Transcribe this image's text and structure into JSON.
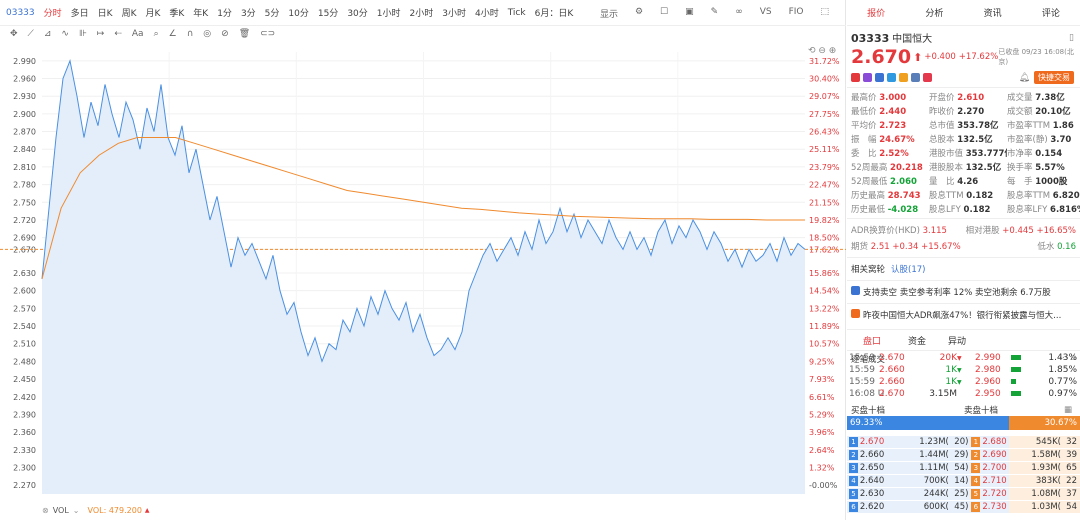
{
  "toolbar": {
    "code": "03333",
    "periods": [
      "分时",
      "多日",
      "日K",
      "周K",
      "月K",
      "季K",
      "年K",
      "1分",
      "3分",
      "5分",
      "10分",
      "15分",
      "30分",
      "1小时",
      "2小时",
      "3小时",
      "4小时",
      "Tick",
      "6月：日K"
    ],
    "right": [
      "显示",
      "VS",
      "FIO"
    ]
  },
  "chart_data": {
    "type": "line",
    "y_ticks": [
      "2.990",
      "2.960",
      "2.930",
      "2.900",
      "2.870",
      "2.840",
      "2.810",
      "2.780",
      "2.750",
      "2.720",
      "2.690",
      "2.670",
      "2.630",
      "2.600",
      "2.570",
      "2.540",
      "2.510",
      "2.480",
      "2.450",
      "2.420",
      "2.390",
      "2.360",
      "2.330",
      "2.300",
      "2.270"
    ],
    "pct_ticks": [
      "31.72%",
      "30.40%",
      "29.07%",
      "27.75%",
      "26.43%",
      "25.11%",
      "23.79%",
      "22.47%",
      "21.15%",
      "19.82%",
      "18.50%",
      "17.62%",
      "15.86%",
      "14.54%",
      "13.22%",
      "11.89%",
      "10.57%",
      "9.25%",
      "7.93%",
      "6.61%",
      "5.29%",
      "3.96%",
      "2.64%",
      "1.32%",
      "-0.00%"
    ],
    "prev_close_line": 2.67,
    "ylim": [
      2.255,
      3.005
    ],
    "price": [
      2.62,
      2.74,
      2.86,
      2.96,
      2.99,
      2.93,
      2.86,
      2.92,
      2.88,
      2.95,
      2.9,
      2.86,
      2.92,
      2.89,
      2.84,
      2.91,
      2.87,
      2.95,
      2.86,
      2.83,
      2.88,
      2.8,
      2.84,
      2.78,
      2.72,
      2.76,
      2.7,
      2.64,
      2.69,
      2.66,
      2.68,
      2.65,
      2.62,
      2.66,
      2.6,
      2.56,
      2.58,
      2.53,
      2.49,
      2.52,
      2.48,
      2.51,
      2.5,
      2.55,
      2.53,
      2.57,
      2.54,
      2.59,
      2.56,
      2.6,
      2.57,
      2.55,
      2.58,
      2.53,
      2.56,
      2.52,
      2.49,
      2.5,
      2.52,
      2.5,
      2.53,
      2.6,
      2.63,
      2.66,
      2.68,
      2.65,
      2.67,
      2.69,
      2.66,
      2.7,
      2.67,
      2.72,
      2.68,
      2.7,
      2.74,
      2.7,
      2.73,
      2.69,
      2.72,
      2.7,
      2.68,
      2.72,
      2.69,
      2.67,
      2.7,
      2.67,
      2.69,
      2.66,
      2.7,
      2.72,
      2.68,
      2.71,
      2.69,
      2.72,
      2.7,
      2.67,
      2.7,
      2.68,
      2.65,
      2.67,
      2.64,
      2.67,
      2.65,
      2.66,
      2.68,
      2.65,
      2.69,
      2.66,
      2.68,
      2.67
    ],
    "avg": [
      2.62,
      2.74,
      2.8,
      2.83,
      2.85,
      2.86,
      2.86,
      2.86,
      2.85,
      2.84,
      2.83,
      2.82,
      2.81,
      2.8,
      2.79,
      2.78,
      2.77,
      2.765,
      2.76,
      2.755,
      2.75,
      2.745,
      2.74,
      2.738,
      2.735,
      2.732,
      2.73,
      2.728,
      2.726,
      2.725,
      2.724,
      2.723,
      2.722,
      2.722,
      2.722,
      2.721,
      2.721,
      2.721,
      2.72,
      2.72,
      2.72
    ]
  },
  "volume": {
    "label": "VOL",
    "value": "VOL: 479.200"
  },
  "tabs": [
    "报价",
    "分析",
    "资讯",
    "评论"
  ],
  "stock": {
    "code": "03333",
    "name": "中国恒大",
    "price": "2.670",
    "change": "+0.400",
    "pct": "+17.62%",
    "closed": "已收盘 09/23 16:08(北京)",
    "fast_trade": "快捷交易"
  },
  "stats": [
    [
      "最高价",
      "3.000",
      "开盘价",
      "2.610",
      "成交量",
      "7.38亿"
    ],
    [
      "最低价",
      "2.440",
      "昨收价",
      "2.270",
      "成交额",
      "20.10亿"
    ],
    [
      "平均价",
      "2.723",
      "总市值",
      "353.78亿",
      "市盈率TTM",
      "1.86"
    ],
    [
      "振　幅",
      "24.67%",
      "总股本",
      "132.5亿",
      "市盈率(静)",
      "3.70"
    ],
    [
      "委　比",
      "2.52%",
      "港股市值",
      "353.777亿",
      "市净率",
      "0.154"
    ],
    [
      "52周最高",
      "20.218",
      "港股股本",
      "132.5亿",
      "换手率",
      "5.57%"
    ],
    [
      "52周最低",
      "2.060",
      "量　比",
      "4.26",
      "每　手",
      "1000股"
    ],
    [
      "历史最高",
      "28.743",
      "股息TTM",
      "0.182",
      "股息率TTM",
      "6.820%"
    ],
    [
      "历史最低",
      "-4.028",
      "股息LFY",
      "0.182",
      "股息率LFY",
      "6.816%"
    ]
  ],
  "adr": {
    "label": "ADR换算价(HKD)",
    "value": "3.115",
    "rel": "相对港股",
    "change": "+0.445",
    "pct": "+16.65%"
  },
  "futures": {
    "label": "期货",
    "price": "2.51",
    "change": "+0.34",
    "pct": "+15.67%",
    "low": "低水",
    "lowval": "0.16"
  },
  "related": {
    "label": "相关窝轮",
    "link": "认股(17)"
  },
  "news": [
    "支持卖空  卖空参考利率 12%  卖空池剩余 6.7万股",
    "昨夜中国恒大ADR飙涨47%！银行衔紧披露与恒大..."
  ],
  "subtabs": [
    "盘口",
    "资金",
    "异动"
  ],
  "trades_title": "逐笔成交",
  "trades": [
    [
      "15:59",
      "2.670",
      "20K"
    ],
    [
      "15:59",
      "2.660",
      "1K"
    ],
    [
      "15:59",
      "2.660",
      "1K"
    ],
    [
      "16:08 U",
      "2.670",
      "3.15M"
    ]
  ],
  "depth": [
    [
      "2.990",
      "1.43%"
    ],
    [
      "2.980",
      "1.85%"
    ],
    [
      "2.960",
      "0.77%"
    ],
    [
      "2.950",
      "0.97%"
    ]
  ],
  "book_title": {
    "bid": "买盘十档",
    "ask": "卖盘十档"
  },
  "ratio": {
    "bid": "69.33%",
    "ask": "30.67%"
  },
  "bids": [
    [
      "2.670",
      "1.23M(",
      "20)"
    ],
    [
      "2.660",
      "1.44M(",
      "29)"
    ],
    [
      "2.650",
      "1.11M(",
      "54)"
    ],
    [
      "2.640",
      "700K(",
      "14)"
    ],
    [
      "2.630",
      "244K(",
      "25)"
    ],
    [
      "2.620",
      "600K(",
      "45)"
    ]
  ],
  "asks": [
    [
      "2.680",
      "545K(",
      "32"
    ],
    [
      "2.690",
      "1.58M(",
      "39"
    ],
    [
      "2.700",
      "1.93M(",
      "65"
    ],
    [
      "2.710",
      "383K(",
      "22"
    ],
    [
      "2.720",
      "1.08M(",
      "37"
    ],
    [
      "2.730",
      "1.03M(",
      "54"
    ]
  ]
}
